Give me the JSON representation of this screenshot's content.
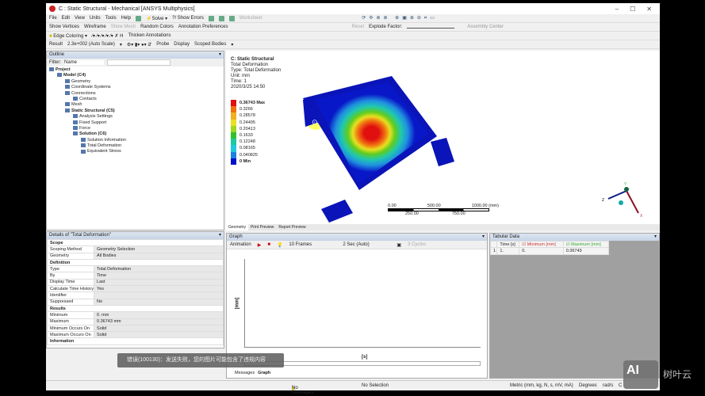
{
  "window": {
    "title": "C : Static Structural - Mechanical [ANSYS Multiphysics]"
  },
  "menu": [
    "File",
    "Edit",
    "View",
    "Units",
    "Tools",
    "Help"
  ],
  "toolbar1": {
    "solve": "Solve",
    "show_errors": "?/ Show Errors",
    "worksheet": "Worksheet"
  },
  "toolbar2": {
    "show_vertices": "Show Vertices",
    "wireframe": "Wireframe",
    "show_mesh": "Show Mesh",
    "random_colors": "Random Colors",
    "annotation_prefs": "Annotation Preferences",
    "reset": "Reset",
    "explode_factor": "Explode Factor:",
    "assembly_center": "Assembly Center"
  },
  "toolbar3": {
    "edge_coloring": "Edge Coloring",
    "thicken": "Thicken Annotations"
  },
  "toolbar4": {
    "result_label": "Result",
    "scale": "2.3e+002 (Auto Scale)",
    "probe": "Probe",
    "display_label": "Display",
    "display_value": "Scoped Bodies"
  },
  "outline": {
    "title": "Outline",
    "filter_label": "Filter:",
    "filter_value": "Name",
    "tree": [
      {
        "label": "Project",
        "level": 0,
        "bold": true
      },
      {
        "label": "Model (C4)",
        "level": 1,
        "bold": true
      },
      {
        "label": "Geometry",
        "level": 2
      },
      {
        "label": "Coordinate Systems",
        "level": 2
      },
      {
        "label": "Connections",
        "level": 2
      },
      {
        "label": "Contacts",
        "level": 3
      },
      {
        "label": "Mesh",
        "level": 2
      },
      {
        "label": "Static Structural (C5)",
        "level": 2,
        "bold": true
      },
      {
        "label": "Analysis Settings",
        "level": 3
      },
      {
        "label": "Fixed Support",
        "level": 3
      },
      {
        "label": "Force",
        "level": 3
      },
      {
        "label": "Solution (C6)",
        "level": 3,
        "bold": true
      },
      {
        "label": "Solution Information",
        "level": 4
      },
      {
        "label": "Total Deformation",
        "level": 4
      },
      {
        "label": "Equivalent Stress",
        "level": 4
      }
    ]
  },
  "viewport": {
    "info": [
      "C: Static Structural",
      "Total Deformation",
      "Type: Total Deformation",
      "Unit: mm",
      "Time: 1",
      "2020/3/25 14:50"
    ],
    "legend": [
      {
        "label": "0.36743 Max",
        "color": "#e01010",
        "bold": true
      },
      {
        "label": "0.3266",
        "color": "#f07010"
      },
      {
        "label": "0.28578",
        "color": "#f0b020"
      },
      {
        "label": "0.24495",
        "color": "#e8e020"
      },
      {
        "label": "0.20413",
        "color": "#a0d820"
      },
      {
        "label": "0.1633",
        "color": "#30c030"
      },
      {
        "label": "0.12248",
        "color": "#20c8a0"
      },
      {
        "label": "0.08165",
        "color": "#20c8e0"
      },
      {
        "label": "0.040825",
        "color": "#2080e0"
      },
      {
        "label": "0 Min",
        "color": "#0010c8",
        "bold": true
      }
    ],
    "scale_top": [
      "0.00",
      "500.00",
      "1000.00 (mm)"
    ],
    "scale_bottom": [
      "250.00",
      "750.00"
    ],
    "axes": {
      "x": "X",
      "y": "Y",
      "z": "Z"
    },
    "tabs": [
      "Geometry",
      "Print Preview",
      "Report Preview"
    ]
  },
  "details": {
    "title": "Details of \"Total Deformation\"",
    "rows": [
      {
        "section": "Scope"
      },
      {
        "k": "Scoping Method",
        "v": "Geometry Selection"
      },
      {
        "k": "Geometry",
        "v": "All Bodies"
      },
      {
        "section": "Definition"
      },
      {
        "k": "Type",
        "v": "Total Deformation"
      },
      {
        "k": "By",
        "v": "Time"
      },
      {
        "k": "Display Time",
        "v": "Last"
      },
      {
        "k": "Calculate Time History",
        "v": "Yes"
      },
      {
        "k": "Identifier",
        "v": ""
      },
      {
        "k": "Suppressed",
        "v": "No"
      },
      {
        "section": "Results"
      },
      {
        "k": "Minimum",
        "v": "0. mm"
      },
      {
        "k": "Maximum",
        "v": "0.36743 mm"
      },
      {
        "k": "Minimum Occurs On",
        "v": "Solid"
      },
      {
        "k": "Maximum Occurs On",
        "v": "Solid"
      },
      {
        "section": "Information"
      }
    ]
  },
  "graph": {
    "title": "Graph",
    "animation": "Animation",
    "frames": "10 Frames",
    "duration": "2 Sec (Auto)",
    "cycles": "3 Cycles",
    "ylabel": "[mm]",
    "xlabel": "[s]",
    "tabs": [
      "Messages",
      "Graph"
    ]
  },
  "tabular": {
    "title": "Tabular Data",
    "headers": [
      "Time [s]",
      "Minimum [mm]",
      "Maximum [mm]"
    ],
    "rows": [
      [
        "1",
        "1.",
        "0.",
        "0.36743"
      ]
    ]
  },
  "status": {
    "messages": "No Messages",
    "selection": "No Selection",
    "units": "Metric (mm, kg, N, s, mV, mA)",
    "degrees": "Degrees",
    "rads": "rad/s",
    "extra": "C"
  },
  "overlay": {
    "error": "错误(100130)：发送失败，您的图片可能包含了违规内容",
    "watermark": "树叶云",
    "logo": "AI"
  }
}
